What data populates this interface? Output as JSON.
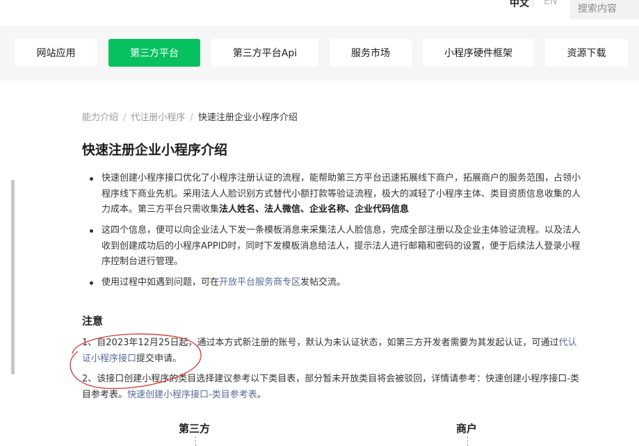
{
  "header": {
    "lang_zh": "中文",
    "lang_en": "EN",
    "search_placeholder": "搜索内容"
  },
  "tabs": [
    {
      "label": "网站应用",
      "active": false
    },
    {
      "label": "第三方平台",
      "active": true
    },
    {
      "label": "第三方平台Api",
      "active": false
    },
    {
      "label": "服务市场",
      "active": false
    },
    {
      "label": "小程序硬件框架",
      "active": false
    },
    {
      "label": "资源下载",
      "active": false
    }
  ],
  "breadcrumb": {
    "items": [
      "能力介绍",
      "代注册小程序"
    ],
    "separator": "/",
    "current": "快速注册企业小程序介绍"
  },
  "title": "快速注册企业小程序介绍",
  "bullets": {
    "b1_text": "快速创建小程序接口优化了小程序注册认证的流程，能帮助第三方平台迅速拓展线下商户，拓展商户的服务范围，占领小程序线下商业先机。采用法人人脸识别方式替代小额打款等验证流程，极大的减轻了小程序主体、类目资质信息收集的人力成本。第三方平台只需收集",
    "b1_bold": "法人姓名、法人微信、企业名称、企业代码信息",
    "b2_text": "这四个信息，便可以向企业法人下发一条模板消息来采集法人人脸信息，完成全部注册以及企业主体验证流程。以及法人收到创建成功后的小程序APPID时，同时下发模板消息给法人，提示法人进行邮箱和密码的设置，便于后续法人登录小程序控制台进行管理。",
    "b3_pre": "使用过程中如遇到问题，可在",
    "b3_link": "开放平台服务商专区",
    "b3_post": "发帖交流。"
  },
  "note": {
    "heading": "注意",
    "n1_pre": "1、自2023年12月25日起，通过本方式新注册的账号，默认为未认证状态，如第三方开发者需要为其发起认证，可通过",
    "n1_link": "代认证小程序接口",
    "n1_post": "提交申请。",
    "n2_pre": "2、该接口创建小程序的类目选择建议参考以下类目表，部分暂未开放类目将会被驳回，详情请参考：快速创建小程序接口-类目参考表。",
    "n2_link": "快速创建小程序接口-类目参考表",
    "n2_post": "。"
  },
  "diagram": {
    "left_label": "第三方",
    "right_label": "商户"
  },
  "colors": {
    "accent": "#07c160",
    "link": "#576b95",
    "annotation": "#d9332e",
    "tabbar_bg": "#f6f6f6"
  }
}
